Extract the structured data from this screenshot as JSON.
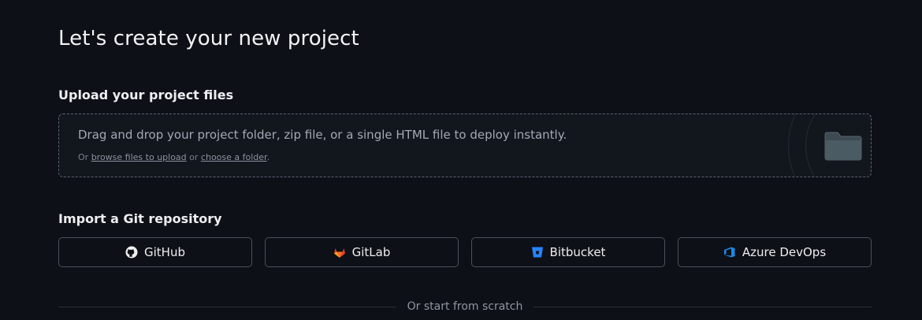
{
  "page": {
    "title": "Let's create your new project"
  },
  "upload": {
    "label": "Upload your project files",
    "main_text": "Drag and drop your project folder, zip file, or a single HTML file to deploy instantly.",
    "sub_prefix": "Or",
    "browse_link": "browse files to upload",
    "sub_or": "or",
    "folder_link": "choose a folder",
    "sub_suffix": "."
  },
  "git": {
    "label": "Import a Git repository",
    "providers": [
      {
        "label": "GitHub",
        "icon": "github-icon",
        "color": "#f0f0f0"
      },
      {
        "label": "GitLab",
        "icon": "gitlab-icon",
        "color": "#e24329"
      },
      {
        "label": "Bitbucket",
        "icon": "bitbucket-icon",
        "color": "#2684ff"
      },
      {
        "label": "Azure DevOps",
        "icon": "azure-devops-icon",
        "color": "#1e88e5"
      }
    ]
  },
  "scratch": {
    "divider_text": "Or start from scratch"
  }
}
